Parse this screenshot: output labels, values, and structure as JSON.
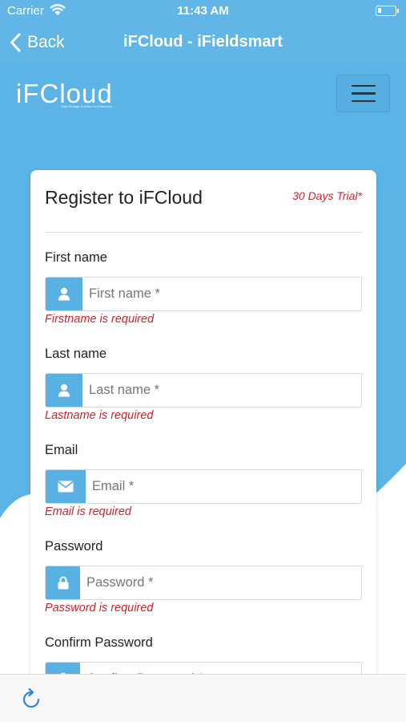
{
  "status_bar": {
    "carrier": "Carrier",
    "time": "11:43 AM",
    "battery_level": 0.2
  },
  "nav": {
    "back_label": "Back",
    "title": "iFCloud - iFieldsmart"
  },
  "header": {
    "logo_text": "iFCloud",
    "logo_tagline": "Data Storage Solution for Enterprise"
  },
  "form": {
    "title": "Register to iFCloud",
    "trial_badge": "30 Days Trial*",
    "fields": [
      {
        "label": "First name",
        "placeholder": "First name *",
        "error": "Firstname is required",
        "icon": "user-icon"
      },
      {
        "label": "Last name",
        "placeholder": "Last name *",
        "error": "Lastname is required",
        "icon": "user-icon"
      },
      {
        "label": "Email",
        "placeholder": "Email *",
        "error": "Email is required",
        "icon": "envelope-icon"
      },
      {
        "label": "Password",
        "placeholder": "Password *",
        "error": "Password is required",
        "icon": "lock-icon"
      },
      {
        "label": "Confirm Password",
        "placeholder": "Confirm Password *",
        "error": "",
        "icon": "lock-icon"
      }
    ]
  },
  "colors": {
    "brand": "#5cb4e6",
    "addon": "#59b0e3",
    "error": "#d0232b"
  },
  "toolbar": {
    "refresh_icon": "refresh-icon"
  }
}
